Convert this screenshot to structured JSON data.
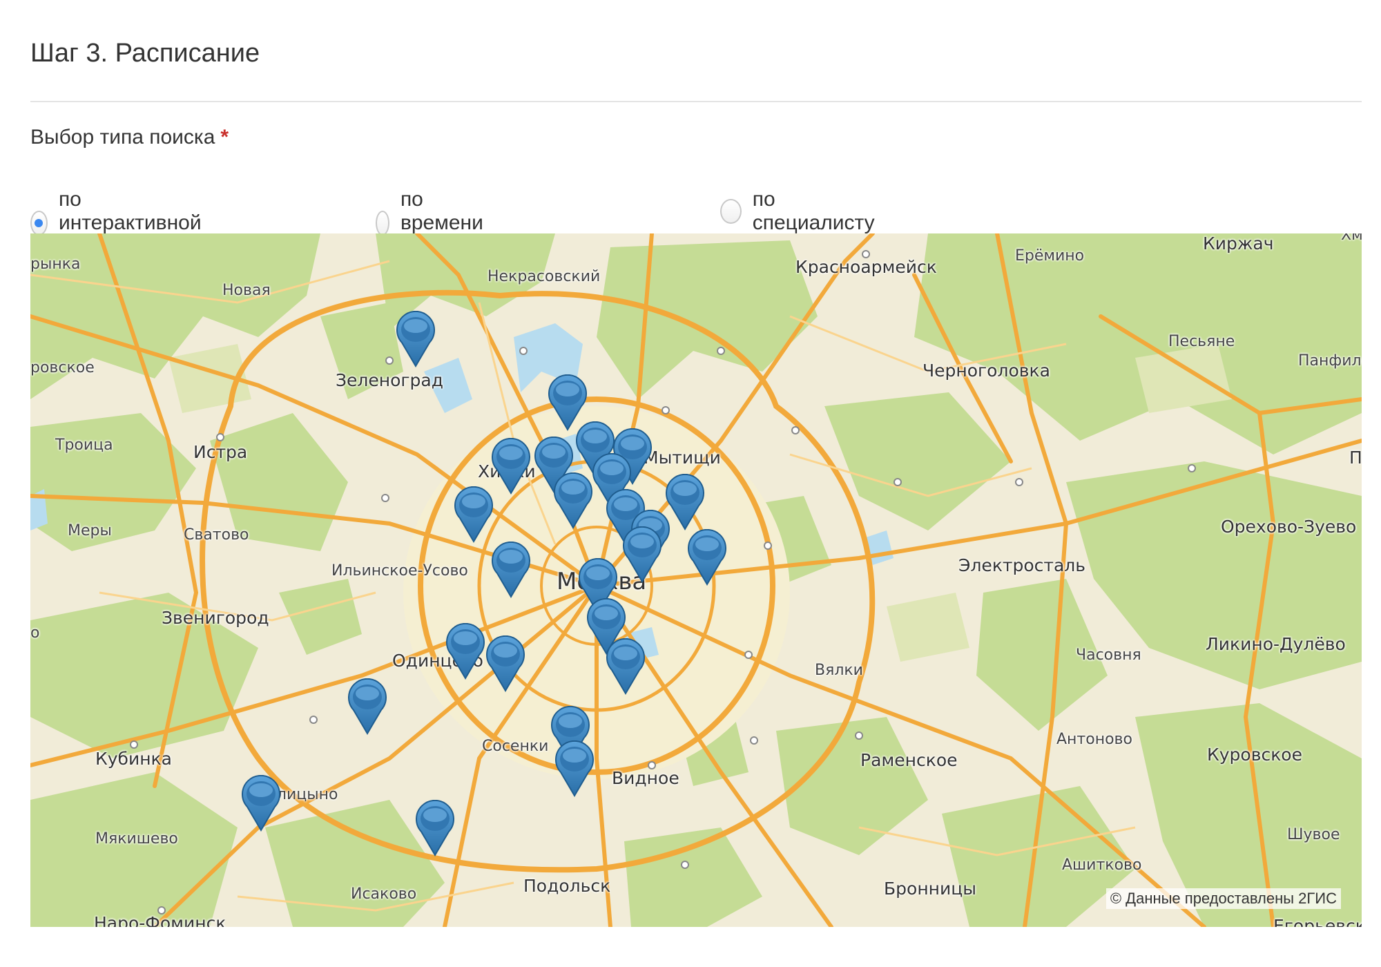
{
  "step_title": "Шаг 3. Расписание",
  "search_type": {
    "label": "Выбор типа поиска",
    "required_mark": "*",
    "options": [
      {
        "label": "по интерактивной карте",
        "checked": true
      },
      {
        "label": "по времени приема",
        "checked": false
      },
      {
        "label": "по специалисту",
        "checked": false
      }
    ]
  },
  "map": {
    "attribution": "© Данные предоставлены 2ГИС",
    "colors": {
      "forest": "#c5dc95",
      "field": "#f1ecd8",
      "urban": "#f4eed0",
      "road": "#f2a93b",
      "water": "#b7dcef",
      "marker": "#3d84c0"
    },
    "labels": {
      "rynka": "рынка",
      "novaya": "Новая",
      "nekrasovsky": "Некрасовский",
      "krasnoarmeysk": "Красноармейск",
      "eremino": "Ерёмино",
      "kirzhach": "Киржач",
      "xm": "Хм",
      "rovskoe": "ровское",
      "zelenograd": "Зеленоград",
      "pesyane": "Песьяне",
      "panfilo": "Панфило",
      "chernogolovka": "Черноголовка",
      "troitsa": "Троица",
      "istra": "Истра",
      "khimki": "Химки",
      "mytishchi": "Мытищи",
      "p_edge": "П",
      "mery": "Меры",
      "svatovo": "Сватово",
      "orekhovo": "Орехово-Зуево",
      "ilinskoe": "Ильинское-Усово",
      "elektrostal": "Электросталь",
      "moskva": "Москва",
      "zvenigorod": "Звенигород",
      "o_edge": "о",
      "likino": "Ликино-Дулёво",
      "odintsovo": "Одинцово",
      "vyalki": "Вялки",
      "chasovnya": "Часовня",
      "antonovo": "Антоново",
      "kurovskoe": "Куровское",
      "kubinka": "Кубинка",
      "sosenki": "Сосенки",
      "ramenskoe": "Раменское",
      "vidnoe": "Видное",
      "golitsyno": "Голицыно",
      "myakishevo": "Мякишево",
      "shuvoe": "Шувое",
      "ashitkovo": "Ашитково",
      "podolsk": "Подольск",
      "bronnitsy": "Бронницы",
      "isakovo": "Исаково",
      "naro": "Наро-Фоминск",
      "egoryevsk": "Егорьевск"
    },
    "markers_count": 27
  }
}
